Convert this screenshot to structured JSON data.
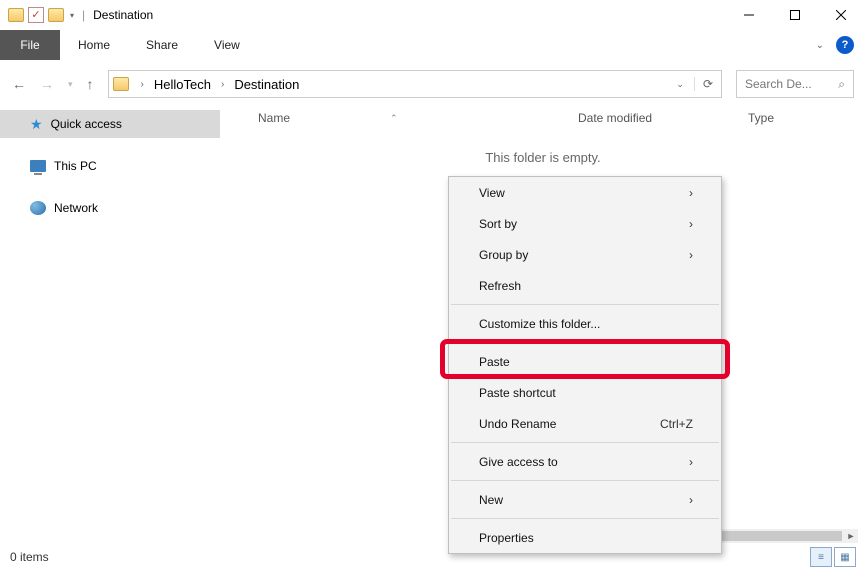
{
  "titlebar": {
    "title": "Destination"
  },
  "ribbon": {
    "file": "File",
    "tabs": [
      "Home",
      "Share",
      "View"
    ]
  },
  "breadcrumb": {
    "segments": [
      "HelloTech",
      "Destination"
    ]
  },
  "search": {
    "placeholder": "Search De..."
  },
  "sidebar": {
    "items": [
      {
        "label": "Quick access"
      },
      {
        "label": "This PC"
      },
      {
        "label": "Network"
      }
    ]
  },
  "columns": {
    "name": "Name",
    "date": "Date modified",
    "type": "Type"
  },
  "empty_message": "This folder is empty.",
  "context_menu": {
    "view": "View",
    "sort_by": "Sort by",
    "group_by": "Group by",
    "refresh": "Refresh",
    "customize": "Customize this folder...",
    "paste": "Paste",
    "paste_shortcut": "Paste shortcut",
    "undo": "Undo Rename",
    "undo_accel": "Ctrl+Z",
    "give_access": "Give access to",
    "new": "New",
    "properties": "Properties"
  },
  "status": {
    "items": "0 items"
  }
}
